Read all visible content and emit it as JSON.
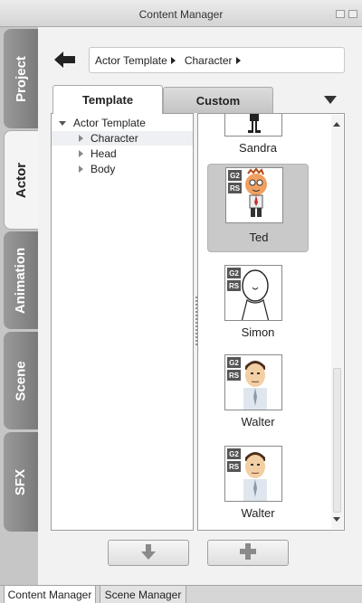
{
  "window": {
    "title": "Content Manager"
  },
  "sidebar": {
    "tabs": [
      {
        "label": "Project",
        "active": false
      },
      {
        "label": "Actor",
        "active": true
      },
      {
        "label": "Animation",
        "active": false
      },
      {
        "label": "Scene",
        "active": false
      },
      {
        "label": "SFX",
        "active": false
      }
    ]
  },
  "breadcrumb": {
    "items": [
      "Actor Template",
      "Character"
    ]
  },
  "tabs": [
    {
      "label": "Template",
      "active": true
    },
    {
      "label": "Custom",
      "active": false
    }
  ],
  "tree": {
    "root": "Actor Template",
    "children": [
      {
        "label": "Character",
        "selected": true
      },
      {
        "label": "Head",
        "selected": false
      },
      {
        "label": "Body",
        "selected": false
      }
    ]
  },
  "grid": {
    "items": [
      {
        "name": "Sandra",
        "badges": [],
        "selected": false
      },
      {
        "name": "Ted",
        "badges": [
          "G2",
          "RS"
        ],
        "selected": true
      },
      {
        "name": "Simon",
        "badges": [
          "G2",
          "RS"
        ],
        "selected": false
      },
      {
        "name": "Walter",
        "badges": [
          "G2",
          "RS"
        ],
        "selected": false
      },
      {
        "name": "Walter",
        "badges": [
          "G2",
          "RS"
        ],
        "selected": false
      }
    ]
  },
  "bottom_tabs": [
    {
      "label": "Content Manager",
      "active": true
    },
    {
      "label": "Scene Manager",
      "active": false
    }
  ],
  "colors": {
    "tab_gray": "#8a8a8a",
    "panel_bg": "#f2f2f2",
    "selected_item": "#c9c9c9"
  }
}
